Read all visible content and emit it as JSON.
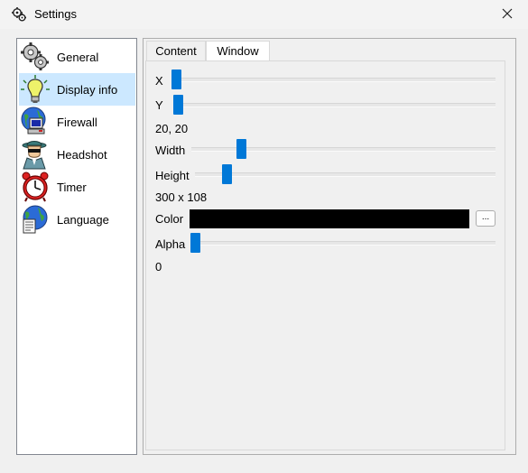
{
  "window": {
    "title": "Settings",
    "close_glyph": "✕"
  },
  "sidebar": {
    "items": [
      {
        "label": "General",
        "icon": "gears-icon"
      },
      {
        "label": "Display info",
        "icon": "lightbulb-icon",
        "selected": true
      },
      {
        "label": "Firewall",
        "icon": "firewall-globe-icon"
      },
      {
        "label": "Headshot",
        "icon": "spy-icon"
      },
      {
        "label": "Timer",
        "icon": "alarm-clock-icon"
      },
      {
        "label": "Language",
        "icon": "globe-document-icon"
      }
    ]
  },
  "tabs": [
    {
      "label": "Content",
      "active": false
    },
    {
      "label": "Window",
      "active": true
    }
  ],
  "window_tab": {
    "x_label": "X",
    "x_fraction": 0.0,
    "y_label": "Y",
    "y_fraction": 0.0,
    "position_text": "20, 20",
    "width_label": "Width",
    "width_fraction": 0.16,
    "height_label": "Height",
    "height_fraction": 0.09,
    "size_text": "300 x 108",
    "color_label": "Color",
    "color_value": "#000000",
    "color_button": "...",
    "alpha_label": "Alpha",
    "alpha_fraction": 0.0,
    "alpha_text": "0"
  },
  "colors": {
    "accent": "#0078d7",
    "selection": "#cce8ff"
  }
}
